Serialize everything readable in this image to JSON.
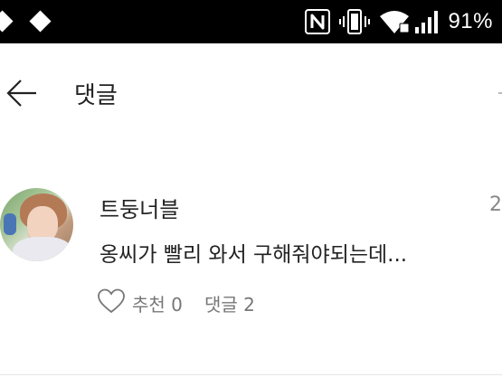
{
  "status_bar": {
    "battery_percent": "91%",
    "icons": [
      "diamond-notification-icon",
      "diamond-notification-icon",
      "nfc-icon",
      "vibrate-icon",
      "wifi-icon",
      "signal-icon"
    ]
  },
  "header": {
    "title": "댓글",
    "back_icon": "arrow-left-icon"
  },
  "comment": {
    "author": "트둥너블",
    "time_partial": "2",
    "text": "옹씨가 빨리 와서 구해줘야되는데...",
    "like_label": "추천 0",
    "reply_label": "댓글 2"
  }
}
